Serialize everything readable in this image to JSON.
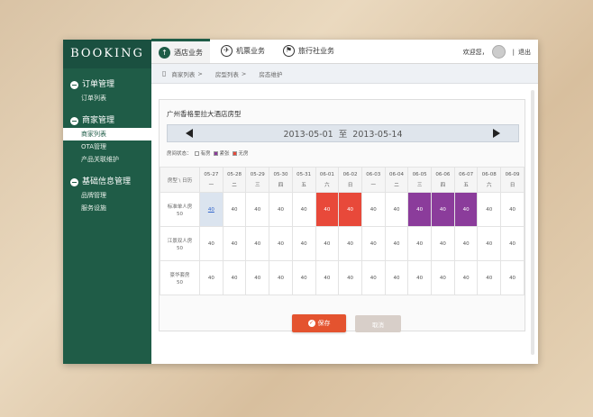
{
  "app": {
    "logo": "BOOKING"
  },
  "header": {
    "tabs": [
      {
        "label": "酒店业务",
        "icon": "upload-circle-icon"
      },
      {
        "label": "机票业务",
        "icon": "plane-icon"
      },
      {
        "label": "旅行社业务",
        "icon": "flag-icon"
      }
    ],
    "welcome": "欢迎您，",
    "separator": "|",
    "logout": "退出"
  },
  "sidebar": {
    "sections": [
      {
        "title": "订单管理",
        "items": [
          "订单列表"
        ]
      },
      {
        "title": "商家管理",
        "items": [
          "商家列表",
          "OTA管理",
          "产品关联维护"
        ]
      },
      {
        "title": "基础信息管理",
        "items": [
          "品牌管理",
          "服务设施"
        ]
      }
    ],
    "active_item": "商家列表"
  },
  "breadcrumb": [
    "商家列表",
    ">",
    "房型列表",
    ">",
    "房态维护"
  ],
  "panel": {
    "title": "广州香格里拉大酒店房型",
    "date_range": "2013-05-01  至  2013-05-14",
    "legend": {
      "label": "房间状态：",
      "items": [
        {
          "name": "有房",
          "color": "#ffffff"
        },
        {
          "name": "紧张",
          "color": "#8b3c9b"
        },
        {
          "name": "无房",
          "color": "#e8493a"
        }
      ]
    },
    "corner_header": "房型 \\ 日历",
    "dates": [
      "05-27",
      "05-28",
      "05-29",
      "05-30",
      "05-31",
      "06-01",
      "06-02",
      "06-03",
      "06-04",
      "06-05",
      "06-06",
      "06-07",
      "06-08",
      "06-09"
    ],
    "weekdays": [
      "一",
      "二",
      "三",
      "四",
      "五",
      "六",
      "日",
      "一",
      "二",
      "三",
      "四",
      "五",
      "六",
      "日"
    ],
    "rooms": [
      {
        "name": "标准单人房",
        "count": "50",
        "values": [
          "40",
          "40",
          "40",
          "40",
          "40",
          "40",
          "40",
          "40",
          "40",
          "40",
          "40",
          "40",
          "40",
          "40"
        ],
        "status": [
          "sel",
          "",
          "",
          "",
          "",
          "red",
          "red",
          "",
          "",
          "purple",
          "purple",
          "purple",
          "",
          ""
        ]
      },
      {
        "name": "江景双人房",
        "count": "50",
        "values": [
          "40",
          "40",
          "40",
          "40",
          "40",
          "40",
          "40",
          "40",
          "40",
          "40",
          "40",
          "40",
          "40",
          "40"
        ],
        "status": [
          "",
          "",
          "",
          "",
          "",
          "",
          "",
          "",
          "",
          "",
          "",
          "",
          "",
          ""
        ]
      },
      {
        "name": "豪华套房",
        "count": "50",
        "values": [
          "40",
          "40",
          "40",
          "40",
          "40",
          "40",
          "40",
          "40",
          "40",
          "40",
          "40",
          "40",
          "40",
          "40"
        ],
        "status": [
          "",
          "",
          "",
          "",
          "",
          "",
          "",
          "",
          "",
          "",
          "",
          "",
          "",
          ""
        ]
      }
    ],
    "save_label": "保存",
    "cancel_label": "取消"
  }
}
